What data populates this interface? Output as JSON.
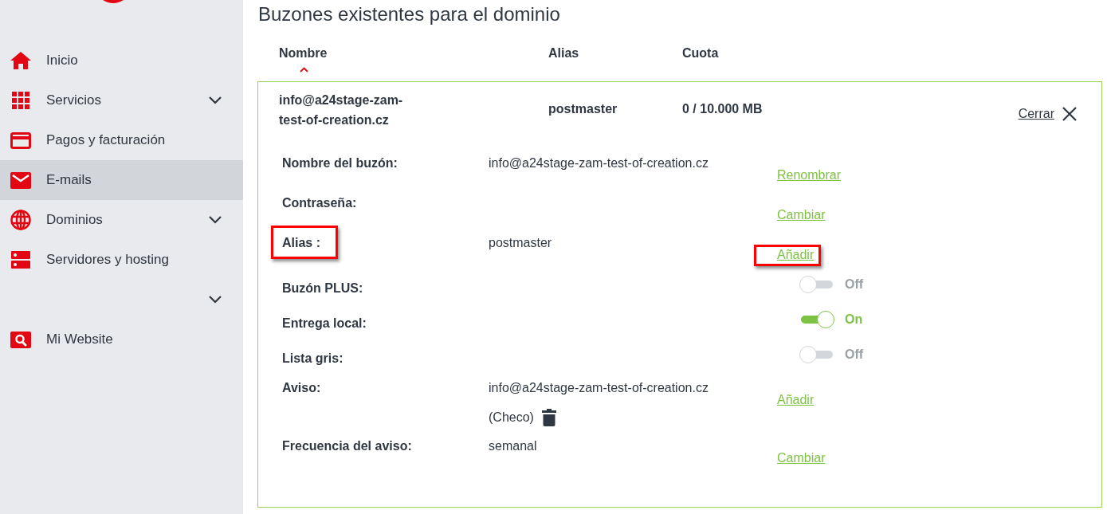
{
  "sidebar": {
    "items": [
      {
        "label": "Inicio",
        "selected": false,
        "expandable": false
      },
      {
        "label": "Servicios",
        "selected": false,
        "expandable": true
      },
      {
        "label": "Pagos y facturación",
        "selected": false,
        "expandable": false
      },
      {
        "label": "E-mails",
        "selected": true,
        "expandable": false
      },
      {
        "label": "Dominios",
        "selected": false,
        "expandable": true
      },
      {
        "label": "Servidores y hosting",
        "selected": false,
        "expandable": false
      },
      {
        "selected": false,
        "expandable": true
      },
      {
        "label": "Mi Website",
        "selected": false,
        "expandable": false
      }
    ]
  },
  "main": {
    "title": "Buzones existentes para el dominio",
    "table": {
      "columns": [
        {
          "label": "Nombre",
          "sorted": true
        },
        {
          "label": "Alias",
          "sorted": false
        },
        {
          "label": "Cuota",
          "sorted": false
        }
      ],
      "rows": [
        {
          "cells": [
            "info@a24stage-zam-test-of-creation.cz",
            "postmaster",
            "0 / 10.000 MB"
          ],
          "expanded": true,
          "close_label": "Cerrar",
          "details": [
            {
              "kind": "link",
              "label": "Nombre del buzón:",
              "value": "info@a24stage-zam-test-of-creation.cz",
              "action": "Renombrar",
              "label_highlighted": false,
              "action_highlighted": false
            },
            {
              "kind": "link",
              "label": "Contraseña:",
              "action": "Cambiar",
              "label_highlighted": false,
              "action_highlighted": false
            },
            {
              "kind": "link",
              "label": "Alias :",
              "value": "postmaster",
              "action": "Añadir",
              "label_highlighted": true,
              "action_highlighted": true
            },
            {
              "kind": "toggle",
              "label": "Buzón PLUS:",
              "on": false,
              "state_label": "Off",
              "label_highlighted": false
            },
            {
              "kind": "toggle",
              "label": "Entrega local:",
              "on": true,
              "state_label": "On",
              "label_highlighted": false
            },
            {
              "kind": "toggle",
              "label": "Lista gris:",
              "on": false,
              "state_label": "Off",
              "label_highlighted": false
            },
            {
              "kind": "link",
              "label": "Aviso:",
              "value": "info@a24stage-zam-test-of-creation.cz",
              "note": "(Checo)",
              "deletable": true,
              "action": "Añadir",
              "label_highlighted": false,
              "action_highlighted": false
            },
            {
              "kind": "link",
              "label": "Frecuencia del aviso:",
              "value": "semanal",
              "action": "Cambiar",
              "label_highlighted": false,
              "action_highlighted": false
            }
          ]
        }
      ]
    }
  }
}
